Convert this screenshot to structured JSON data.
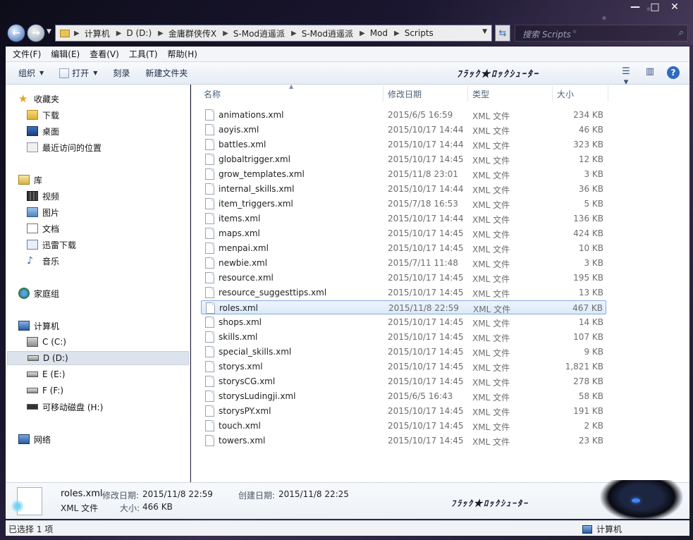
{
  "window": {
    "caption_buttons": [
      "—",
      "□",
      "✕"
    ]
  },
  "address": {
    "crumbs": [
      "计算机",
      "D (D:)",
      "金庸群侠传X",
      "S-Mod逍遥派",
      "S-Mod逍遥派",
      "Mod",
      "Scripts"
    ],
    "search_placeholder": "搜索 Scripts"
  },
  "menu": [
    "文件(F)",
    "编辑(E)",
    "查看(V)",
    "工具(T)",
    "帮助(H)"
  ],
  "toolbar": {
    "organize": "组织",
    "open": "打开",
    "burn": "刻录",
    "new_folder": "新建文件夹",
    "banner": "ﾌﾗｯｸ★ﾛｯｸｼｭｰﾀｰ"
  },
  "nav": {
    "favorites": {
      "header": "收藏夹",
      "items": [
        "下载",
        "桌面",
        "最近访问的位置"
      ]
    },
    "libraries": {
      "header": "库",
      "items": [
        "视频",
        "图片",
        "文档",
        "迅雷下载",
        "音乐"
      ]
    },
    "homegroup": "家庭组",
    "computer": {
      "header": "计算机",
      "items": [
        "C (C:)",
        "D (D:)",
        "E (E:)",
        "F (F:)",
        "可移动磁盘 (H:)"
      ]
    },
    "network": "网络"
  },
  "columns": {
    "name": "名称",
    "date": "修改日期",
    "type": "类型",
    "size": "大小"
  },
  "files": [
    {
      "name": "animations.xml",
      "date": "2015/6/5 16:59",
      "type": "XML 文件",
      "size": "234 KB"
    },
    {
      "name": "aoyis.xml",
      "date": "2015/10/17 14:44",
      "type": "XML 文件",
      "size": "46 KB"
    },
    {
      "name": "battles.xml",
      "date": "2015/10/17 14:44",
      "type": "XML 文件",
      "size": "323 KB"
    },
    {
      "name": "globaltrigger.xml",
      "date": "2015/10/17 14:45",
      "type": "XML 文件",
      "size": "12 KB"
    },
    {
      "name": "grow_templates.xml",
      "date": "2015/11/8 23:01",
      "type": "XML 文件",
      "size": "3 KB"
    },
    {
      "name": "internal_skills.xml",
      "date": "2015/10/17 14:44",
      "type": "XML 文件",
      "size": "36 KB"
    },
    {
      "name": "item_triggers.xml",
      "date": "2015/7/18 16:53",
      "type": "XML 文件",
      "size": "5 KB"
    },
    {
      "name": "items.xml",
      "date": "2015/10/17 14:44",
      "type": "XML 文件",
      "size": "136 KB"
    },
    {
      "name": "maps.xml",
      "date": "2015/10/17 14:45",
      "type": "XML 文件",
      "size": "424 KB"
    },
    {
      "name": "menpai.xml",
      "date": "2015/10/17 14:45",
      "type": "XML 文件",
      "size": "10 KB"
    },
    {
      "name": "newbie.xml",
      "date": "2015/7/11 11:48",
      "type": "XML 文件",
      "size": "3 KB"
    },
    {
      "name": "resource.xml",
      "date": "2015/10/17 14:45",
      "type": "XML 文件",
      "size": "195 KB"
    },
    {
      "name": "resource_suggesttips.xml",
      "date": "2015/10/17 14:45",
      "type": "XML 文件",
      "size": "13 KB"
    },
    {
      "name": "roles.xml",
      "date": "2015/11/8 22:59",
      "type": "XML 文件",
      "size": "467 KB",
      "selected": true
    },
    {
      "name": "shops.xml",
      "date": "2015/10/17 14:45",
      "type": "XML 文件",
      "size": "14 KB"
    },
    {
      "name": "skills.xml",
      "date": "2015/10/17 14:45",
      "type": "XML 文件",
      "size": "107 KB"
    },
    {
      "name": "special_skills.xml",
      "date": "2015/10/17 14:45",
      "type": "XML 文件",
      "size": "9 KB"
    },
    {
      "name": "storys.xml",
      "date": "2015/10/17 14:45",
      "type": "XML 文件",
      "size": "1,821 KB"
    },
    {
      "name": "storysCG.xml",
      "date": "2015/10/17 14:45",
      "type": "XML 文件",
      "size": "278 KB"
    },
    {
      "name": "storysLudingji.xml",
      "date": "2015/6/5 16:43",
      "type": "XML 文件",
      "size": "58 KB"
    },
    {
      "name": "storysPY.xml",
      "date": "2015/10/17 14:45",
      "type": "XML 文件",
      "size": "191 KB"
    },
    {
      "name": "touch.xml",
      "date": "2015/10/17 14:45",
      "type": "XML 文件",
      "size": "2 KB"
    },
    {
      "name": "towers.xml",
      "date": "2015/10/17 14:45",
      "type": "XML 文件",
      "size": "23 KB"
    }
  ],
  "details": {
    "name": "roles.xml",
    "type": "XML 文件",
    "modified_label": "修改日期:",
    "modified_value": "2015/11/8 22:59",
    "created_label": "创建日期:",
    "created_value": "2015/11/8 22:25",
    "size_label": "大小:",
    "size_value": "466 KB",
    "banner": "ﾌﾗｯｸ★ﾛｯｸｼｭｰﾀｰ"
  },
  "status": {
    "selection": "已选择 1 项",
    "location": "计算机"
  }
}
